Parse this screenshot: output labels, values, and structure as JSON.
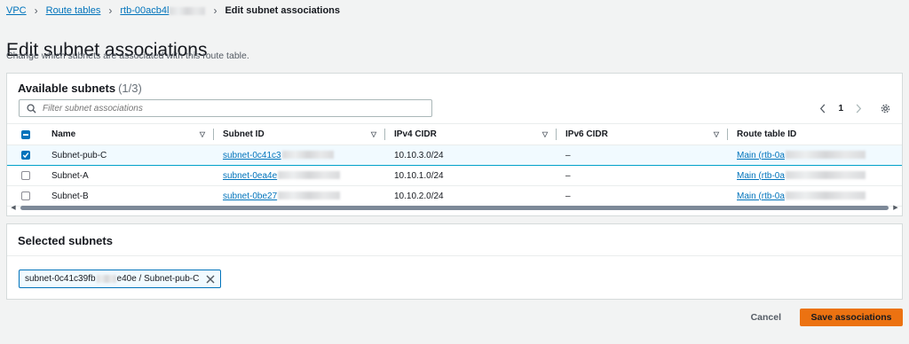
{
  "breadcrumb": {
    "items": [
      "VPC",
      "Route tables",
      "rtb-00acb4l"
    ],
    "current": "Edit subnet associations"
  },
  "page": {
    "title": "Edit subnet associations",
    "description": "Change which subnets are associated with this route table."
  },
  "available": {
    "title": "Available subnets",
    "count": "(1/3)",
    "filter_placeholder": "Filter subnet associations",
    "page_number": "1",
    "columns": [
      "Name",
      "Subnet ID",
      "IPv4 CIDR",
      "IPv6 CIDR",
      "Route table ID"
    ],
    "rows": [
      {
        "selected": true,
        "name": "Subnet-pub-C",
        "subnet_id": "subnet-0c41c3",
        "ipv4": "10.10.3.0/24",
        "ipv6": "–",
        "route_table": "Main (rtb-0a"
      },
      {
        "selected": false,
        "name": "Subnet-A",
        "subnet_id": "subnet-0ea4e",
        "ipv4": "10.10.1.0/24",
        "ipv6": "–",
        "route_table": "Main (rtb-0a"
      },
      {
        "selected": false,
        "name": "Subnet-B",
        "subnet_id": "subnet-0be27",
        "ipv4": "10.10.2.0/24",
        "ipv6": "–",
        "route_table": "Main (rtb-0a"
      }
    ]
  },
  "selected": {
    "title": "Selected subnets",
    "token_prefix": "subnet-0c41c39fb",
    "token_suffix": "e40e / Subnet-pub-C"
  },
  "actions": {
    "cancel": "Cancel",
    "save": "Save associations"
  },
  "colors": {
    "link": "#0073bb",
    "primary_button": "#ec7211",
    "selected_row": "#f1faff"
  }
}
